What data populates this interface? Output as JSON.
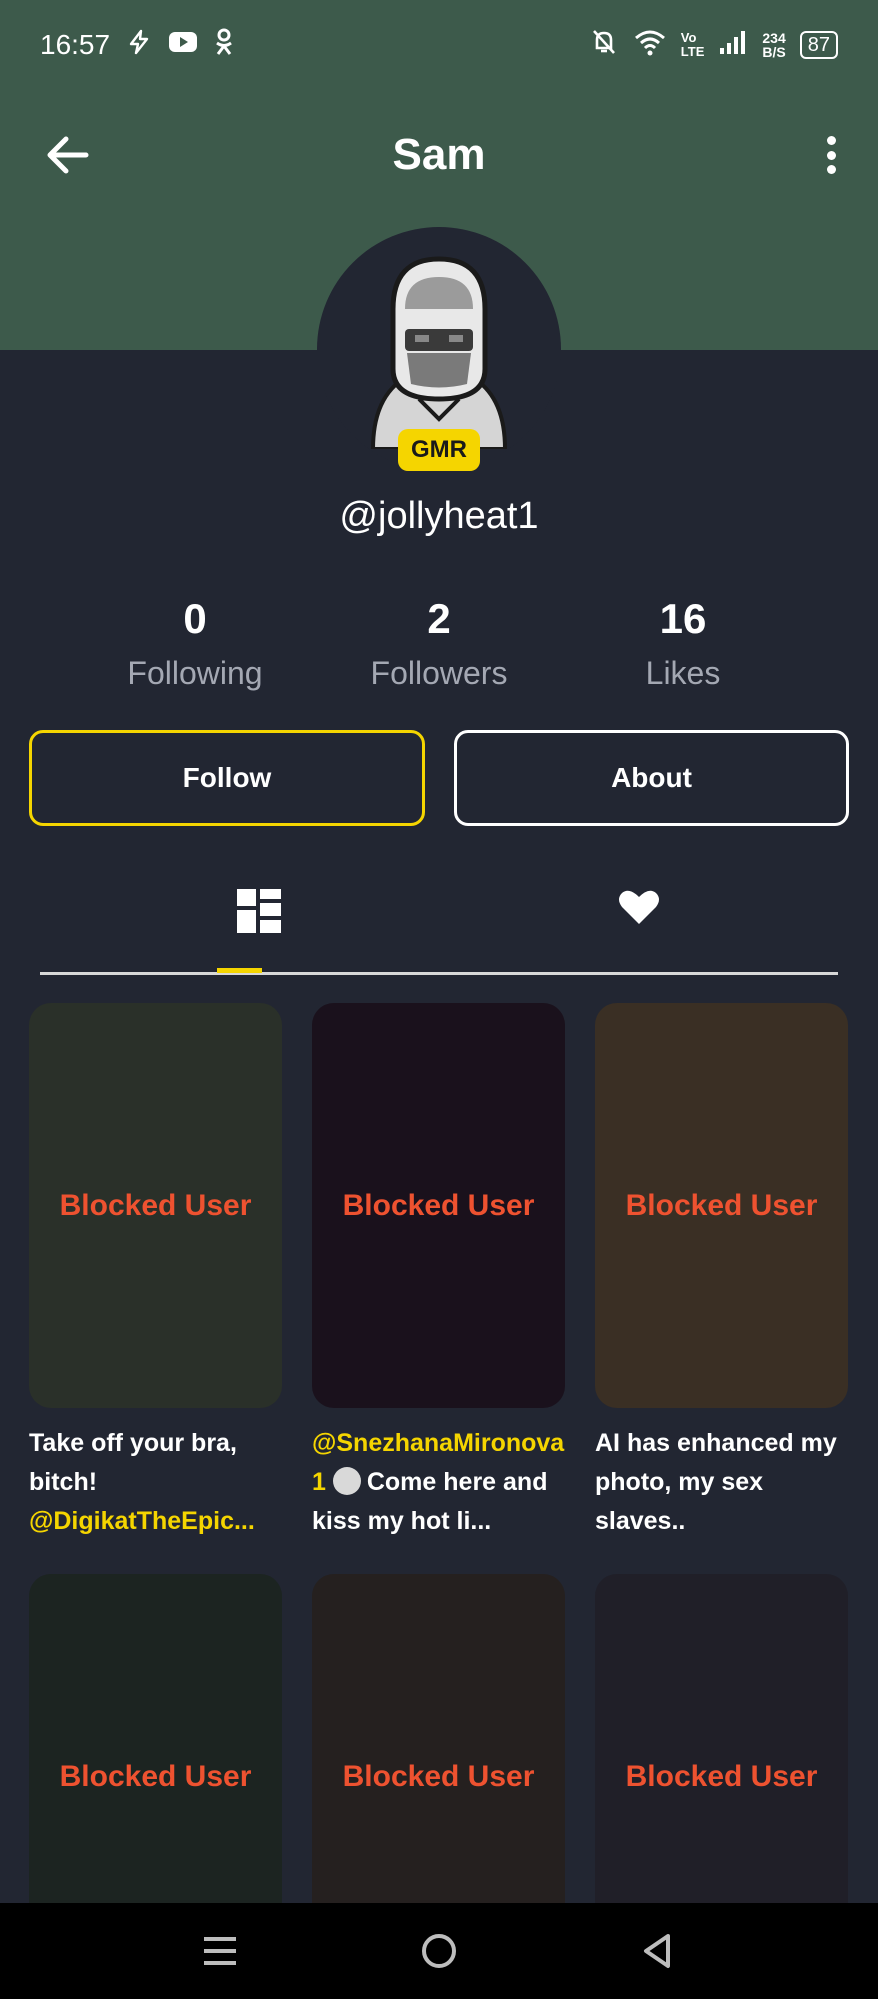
{
  "status_bar": {
    "time": "16:57",
    "volte_top": "Vo",
    "volte_bottom": "LTE",
    "net_speed_value": "234",
    "net_speed_unit": "B/S",
    "battery": "87"
  },
  "header": {
    "title": "Sam"
  },
  "profile": {
    "badge": "GMR",
    "username": "@jollyheat1"
  },
  "stats": [
    {
      "value": "0",
      "label": "Following"
    },
    {
      "value": "2",
      "label": "Followers"
    },
    {
      "value": "16",
      "label": "Likes"
    }
  ],
  "buttons": {
    "follow": "Follow",
    "about": "About"
  },
  "videos": [
    {
      "status": "Blocked User",
      "caption_text": "Take off your bra, bitch!",
      "caption_mention": "@DigikatTheEpic...",
      "bg": "#2a3029"
    },
    {
      "status": "Blocked User",
      "caption_mention": "@SnezhanaMironova1",
      "caption_text": "Come here and kiss my hot li...",
      "bg": "#1a111c"
    },
    {
      "status": "Blocked User",
      "caption_text": "AI has enhanced my photo, my sex slaves..",
      "bg": "#3a2f24"
    },
    {
      "status": "Blocked User",
      "bg": "#1c2421"
    },
    {
      "status": "Blocked User",
      "bg": "#25201f"
    },
    {
      "status": "Blocked User",
      "bg": "#201f28"
    }
  ],
  "colors": {
    "header": "#3d5a4b",
    "background": "#222632",
    "accent": "#f5d500",
    "blocked_text": "#ee5230"
  }
}
